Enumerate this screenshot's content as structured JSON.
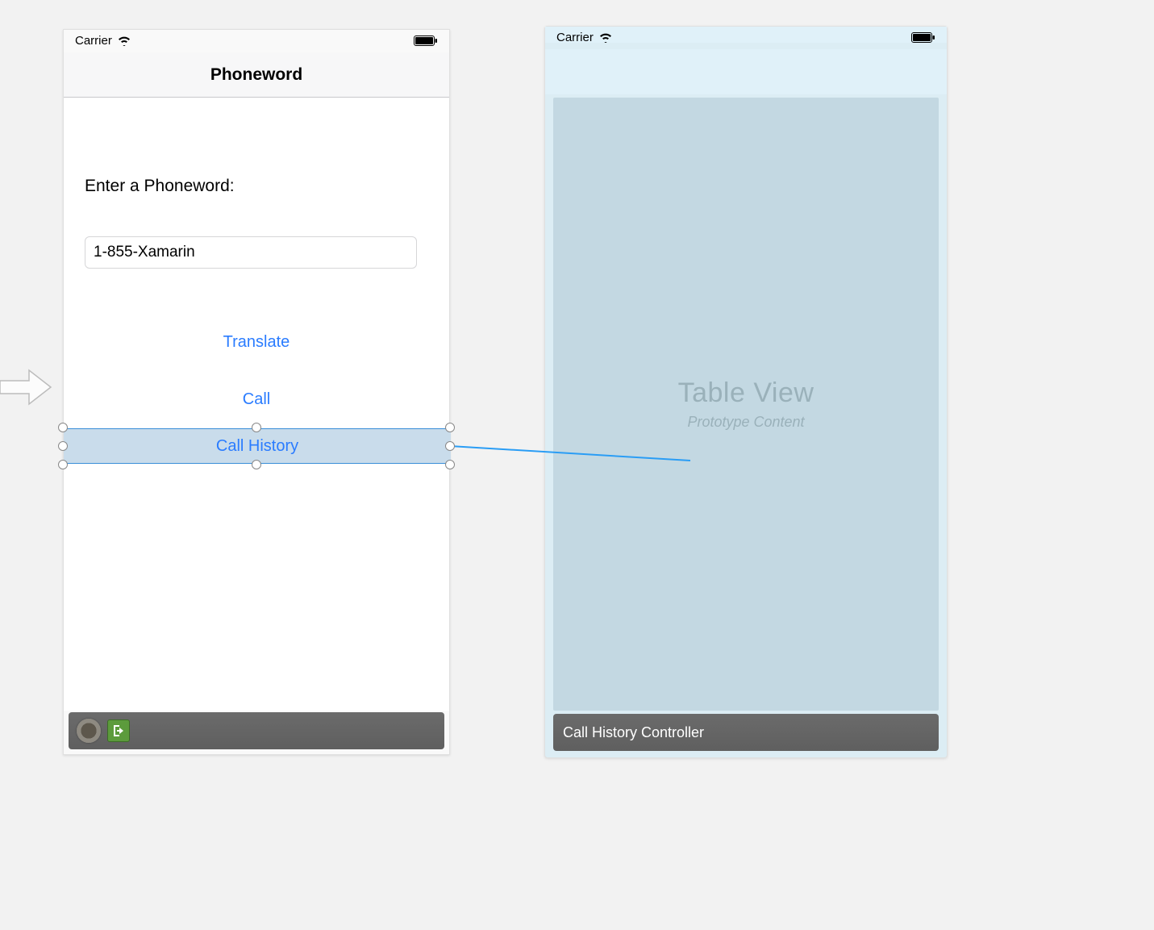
{
  "left": {
    "status": {
      "carrier": "Carrier"
    },
    "nav": {
      "title": "Phoneword"
    },
    "form": {
      "label": "Enter a Phoneword:",
      "input_value": "1-855-Xamarin"
    },
    "buttons": {
      "translate": "Translate",
      "call": "Call",
      "call_history": "Call History"
    }
  },
  "right": {
    "status": {
      "carrier": "Carrier"
    },
    "table": {
      "title": "Table View",
      "subtitle": "Prototype Content"
    },
    "footer": {
      "label": "Call History Controller"
    }
  }
}
